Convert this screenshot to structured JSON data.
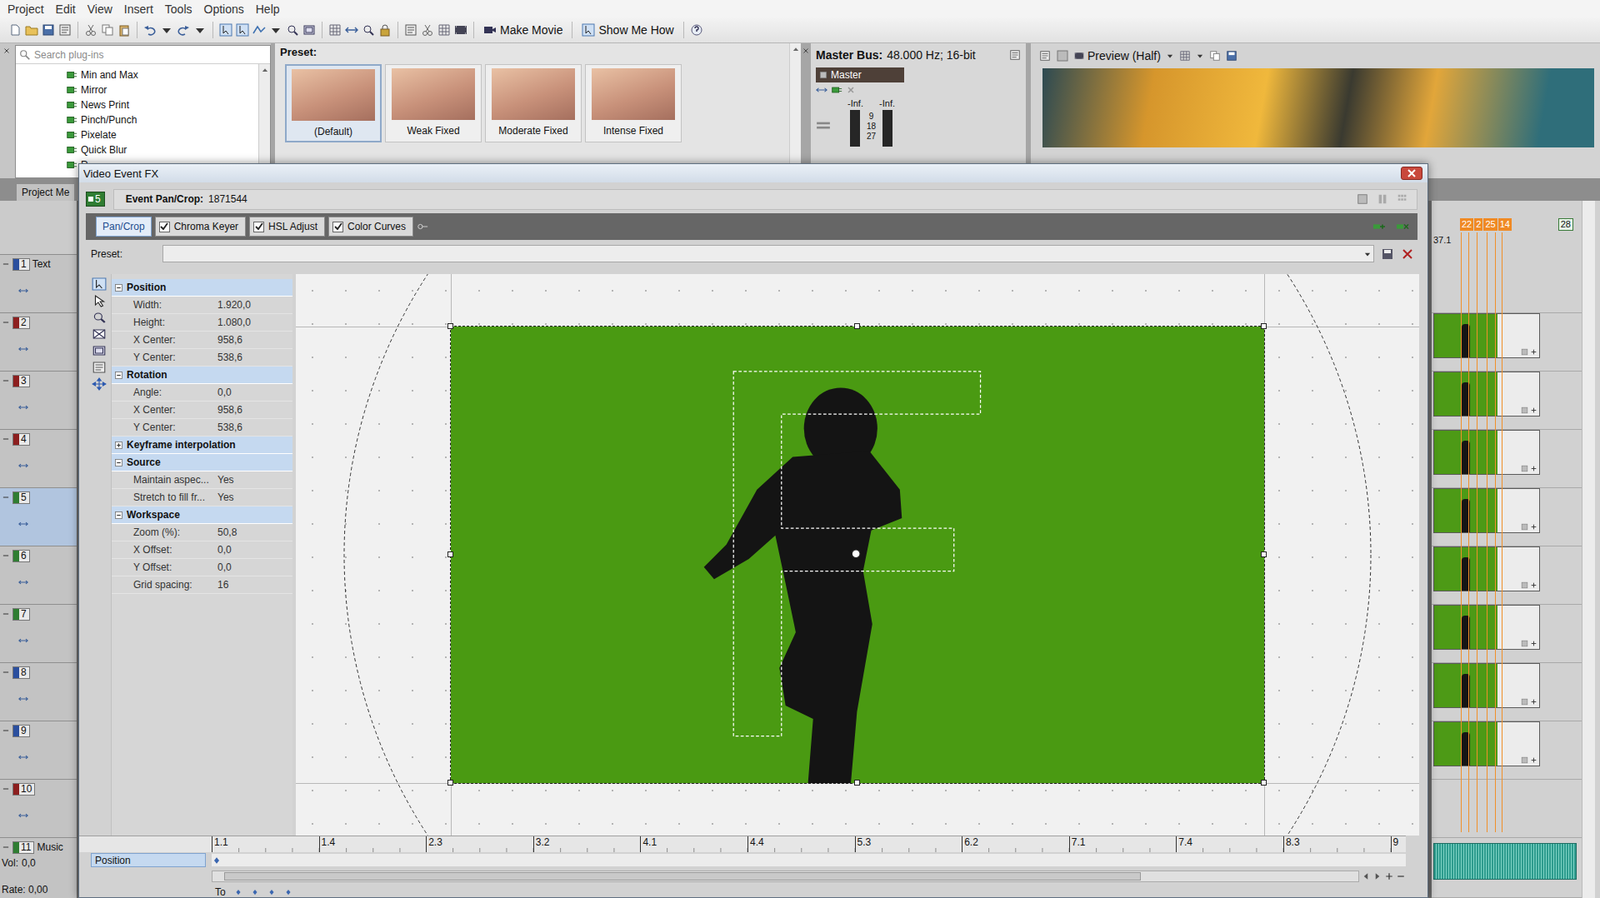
{
  "menu": [
    "Project",
    "Edit",
    "View",
    "Insert",
    "Tools",
    "Options",
    "Help"
  ],
  "toolbar": {
    "buttons": [
      "Make Movie",
      "Show Me How"
    ]
  },
  "plugins": {
    "placeholder": "Search plug-ins",
    "items": [
      "Min and Max",
      "Mirror",
      "News Print",
      "Pinch/Punch",
      "Pixelate",
      "Quick Blur",
      "R"
    ],
    "tab": "Project Me"
  },
  "presets": {
    "label": "Preset:",
    "items": [
      {
        "label": "(Default)",
        "selected": true
      },
      {
        "label": "Weak Fixed",
        "selected": false
      },
      {
        "label": "Moderate Fixed",
        "selected": false
      },
      {
        "label": "Intense Fixed",
        "selected": false
      }
    ]
  },
  "master_bus": {
    "title": "Master Bus:",
    "info": "48.000 Hz; 16-bit",
    "channel": "Master",
    "meters": [
      {
        "reading": "-Inf.",
        "level": 0
      },
      {
        "reading": "-Inf.",
        "level": 0
      }
    ],
    "scale": [
      "9",
      "18",
      "27"
    ]
  },
  "preview": {
    "mode": "Preview (Half)"
  },
  "tracks": [
    {
      "number": "1",
      "name": "Text",
      "color": "#2b4f9e",
      "selected": false,
      "kind": "video",
      "clip": false
    },
    {
      "number": "2",
      "color": "#8c1f1f",
      "selected": false,
      "kind": "video",
      "clip": true
    },
    {
      "number": "3",
      "color": "#8c1f1f",
      "selected": false,
      "kind": "video",
      "clip": true
    },
    {
      "number": "4",
      "color": "#8c1f1f",
      "selected": false,
      "kind": "video",
      "clip": true
    },
    {
      "number": "5",
      "color": "#2f7d32",
      "selected": true,
      "kind": "video",
      "clip": true
    },
    {
      "number": "6",
      "color": "#2f7d32",
      "selected": false,
      "kind": "video",
      "clip": true
    },
    {
      "number": "7",
      "color": "#2f7d32",
      "selected": false,
      "kind": "video",
      "clip": true
    },
    {
      "number": "8",
      "color": "#2b4f9e",
      "selected": false,
      "kind": "video",
      "clip": true
    },
    {
      "number": "9",
      "color": "#2b4f9e",
      "selected": false,
      "kind": "video",
      "clip": true
    },
    {
      "number": "10",
      "color": "#8c1f1f",
      "selected": false,
      "kind": "video",
      "clip": false
    },
    {
      "number": "11",
      "name": "Music",
      "color": "#2f7d32",
      "selected": false,
      "kind": "audio",
      "clip": true
    }
  ],
  "audio": {
    "vol_label": "Vol:",
    "vol": "0,0",
    "rate": "Rate: 0,00"
  },
  "timeline": {
    "markers": [
      "22",
      "2",
      "25",
      "14"
    ],
    "region": "28",
    "position": "37.1"
  },
  "fx": {
    "title": "Video Event FX",
    "track": "5",
    "event_label": "Event Pan/Crop:",
    "event_id": "1871544",
    "chain": [
      {
        "label": "Pan/Crop",
        "kind": "plain",
        "selected": true
      },
      {
        "label": "Chroma Keyer",
        "kind": "toggle",
        "checked": true,
        "selected": false
      },
      {
        "label": "HSL Adjust",
        "kind": "toggle",
        "checked": true,
        "selected": false
      },
      {
        "label": "Color Curves",
        "kind": "toggle",
        "checked": true,
        "selected": false
      }
    ],
    "preset_label": "Preset:",
    "sections": [
      {
        "name": "Position",
        "expanded": true,
        "rows": [
          {
            "label": "Width:",
            "value": "1.920,0"
          },
          {
            "label": "Height:",
            "value": "1.080,0"
          },
          {
            "label": "X Center:",
            "value": "958,6"
          },
          {
            "label": "Y Center:",
            "value": "538,6"
          }
        ]
      },
      {
        "name": "Rotation",
        "expanded": true,
        "rows": [
          {
            "label": "Angle:",
            "value": "0,0"
          },
          {
            "label": "X Center:",
            "value": "958,6"
          },
          {
            "label": "Y Center:",
            "value": "538,6"
          }
        ]
      },
      {
        "name": "Keyframe interpolation",
        "expanded": false,
        "rows": []
      },
      {
        "name": "Source",
        "expanded": true,
        "rows": [
          {
            "label": "Maintain aspec...",
            "value": "Yes"
          },
          {
            "label": "Stretch to fill fr...",
            "value": "Yes"
          }
        ]
      },
      {
        "name": "Workspace",
        "expanded": true,
        "rows": [
          {
            "label": "Zoom (%):",
            "value": "50,8"
          },
          {
            "label": "X Offset:",
            "value": "0,0"
          },
          {
            "label": "Y Offset:",
            "value": "0,0"
          },
          {
            "label": "Grid spacing:",
            "value": "16"
          }
        ]
      }
    ],
    "ruler": [
      "1.1",
      "1.4",
      "2.3",
      "3.2",
      "4.1",
      "4.4",
      "5.3",
      "6.2",
      "7.1",
      "7.4",
      "8.3",
      "9"
    ],
    "keyframe_track": {
      "label": "Position",
      "selected": true
    },
    "footer": "To"
  }
}
